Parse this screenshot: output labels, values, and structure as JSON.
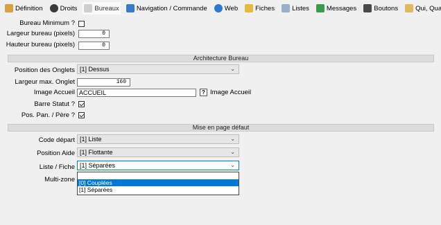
{
  "tabs": [
    {
      "label": "Définition",
      "icon": "definition-icon",
      "color": "#d8a040"
    },
    {
      "label": "Droits",
      "icon": "user-icon",
      "color": "#3a3a3a"
    },
    {
      "label": "Bureaux",
      "icon": "book-icon",
      "color": "#cfcfcf",
      "active": true
    },
    {
      "label": "Navigation / Commande",
      "icon": "navigation-icon",
      "color": "#3a78c8"
    },
    {
      "label": "Web",
      "icon": "globe-icon",
      "color": "#2a7ad0"
    },
    {
      "label": "Fiches",
      "icon": "folder-icon",
      "color": "#e8b840"
    },
    {
      "label": "Listes",
      "icon": "list-icon",
      "color": "#9ab0c8"
    },
    {
      "label": "Messages",
      "icon": "messages-icon",
      "color": "#3a9a50"
    },
    {
      "label": "Boutons",
      "icon": "pen-icon",
      "color": "#4a4a4a"
    },
    {
      "label": "Qui, Quand ?",
      "icon": "who-when-icon",
      "color": "#e0b860"
    }
  ],
  "general": {
    "bureau_minimum_label": "Bureau Minimum ?",
    "largeur_label": "Largeur bureau (pixels)",
    "largeur_value": "0",
    "hauteur_label": "Hauteur bureau (pixels)",
    "hauteur_value": "0"
  },
  "architecture": {
    "section_title": "Architecture Bureau",
    "position_onglets_label": "Position des Onglets",
    "position_onglets_value": "[1] Dessus",
    "largeur_onglet_label": "Largeur max. Onglet",
    "largeur_onglet_value": "160",
    "image_accueil_label": "Image Accueil",
    "image_accueil_value": "ACCUEIL",
    "image_accueil_help": "?",
    "image_accueil_hint": "Image Accueil",
    "barre_statut_label": "Barre Statut ?",
    "pos_pan_label": "Pos. Pan. / Père ?"
  },
  "mise_en_page": {
    "section_title": "Mise en page défaut",
    "code_depart_label": "Code départ",
    "code_depart_value": "[1] Liste",
    "position_aide_label": "Position Aide",
    "position_aide_value": "[1] Flottante",
    "liste_fiche_label": "Liste / Fiche",
    "liste_fiche_value": "[1] Séparées",
    "multizone_label": "Multi-zone",
    "dropdown_options": [
      "[0] Couplées",
      "[1] Séparées"
    ]
  }
}
